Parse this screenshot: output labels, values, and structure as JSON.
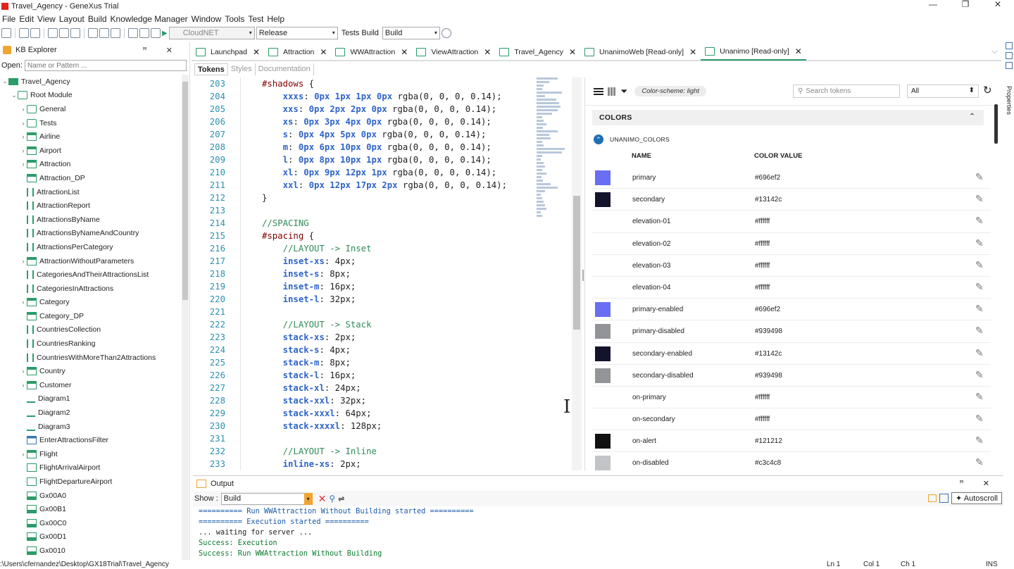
{
  "window": {
    "title": "Travel_Agency - GeneXus Trial",
    "controls": [
      "—",
      "❐",
      "✕"
    ]
  },
  "menu": [
    "File",
    "Edit",
    "View",
    "Layout",
    "Build",
    "Knowledge Manager",
    "Window",
    "Tools",
    "Test",
    "Help"
  ],
  "toolbar": {
    "platform": "CloudNET",
    "configuration": "Release",
    "tests_label": "Tests Build",
    "tests_value": "Build"
  },
  "kb_explorer": {
    "title": "KB Explorer",
    "controls": "ꟸ ✕",
    "open_label": "Open:",
    "open_placeholder": "Name or Pattern ...",
    "tree": [
      {
        "label": "Travel_Agency",
        "exp": "⌄",
        "indent": 0,
        "icon": "kb"
      },
      {
        "label": "Root Module",
        "exp": "⌄",
        "indent": 1,
        "icon": "folder"
      },
      {
        "label": "General",
        "exp": "›",
        "indent": 2,
        "icon": "folder"
      },
      {
        "label": "Tests",
        "exp": "›",
        "indent": 2,
        "icon": "folder"
      },
      {
        "label": "Airline",
        "exp": "›",
        "indent": 2,
        "icon": "trn"
      },
      {
        "label": "Airport",
        "exp": "›",
        "indent": 2,
        "icon": "trn"
      },
      {
        "label": "Attraction",
        "exp": "›",
        "indent": 2,
        "icon": "trn"
      },
      {
        "label": "Attraction_DP",
        "exp": "",
        "indent": 2,
        "icon": "dp"
      },
      {
        "label": "AttractionList",
        "exp": "",
        "indent": 2,
        "icon": "proc"
      },
      {
        "label": "AttractionReport",
        "exp": "",
        "indent": 2,
        "icon": "proc"
      },
      {
        "label": "AttractionsByName",
        "exp": "",
        "indent": 2,
        "icon": "proc"
      },
      {
        "label": "AttractionsByNameAndCountry",
        "exp": "",
        "indent": 2,
        "icon": "proc"
      },
      {
        "label": "AttractionsPerCategory",
        "exp": "",
        "indent": 2,
        "icon": "proc"
      },
      {
        "label": "AttractionWithoutParameters",
        "exp": "›",
        "indent": 2,
        "icon": "trn"
      },
      {
        "label": "CategoriesAndTheirAttractionsList",
        "exp": "",
        "indent": 2,
        "icon": "proc"
      },
      {
        "label": "CategoriesInAttractions",
        "exp": "",
        "indent": 2,
        "icon": "proc"
      },
      {
        "label": "Category",
        "exp": "›",
        "indent": 2,
        "icon": "trn"
      },
      {
        "label": "Category_DP",
        "exp": "",
        "indent": 2,
        "icon": "dp"
      },
      {
        "label": "CountriesCollection",
        "exp": "",
        "indent": 2,
        "icon": "proc"
      },
      {
        "label": "CountriesRanking",
        "exp": "",
        "indent": 2,
        "icon": "proc"
      },
      {
        "label": "CountriesWithMoreThan2Attractions",
        "exp": "",
        "indent": 2,
        "icon": "proc"
      },
      {
        "label": "Country",
        "exp": "›",
        "indent": 2,
        "icon": "trn"
      },
      {
        "label": "Customer",
        "exp": "›",
        "indent": 2,
        "icon": "trn"
      },
      {
        "label": "Diagram1",
        "exp": "",
        "indent": 2,
        "icon": "diag"
      },
      {
        "label": "Diagram2",
        "exp": "",
        "indent": 2,
        "icon": "diag"
      },
      {
        "label": "Diagram3",
        "exp": "",
        "indent": 2,
        "icon": "diag"
      },
      {
        "label": "EnterAttractionsFilter",
        "exp": "",
        "indent": 2,
        "icon": "wp"
      },
      {
        "label": "Flight",
        "exp": "›",
        "indent": 2,
        "icon": "trn"
      },
      {
        "label": "FlightArrivalAirport",
        "exp": "",
        "indent": 2,
        "icon": "sdt"
      },
      {
        "label": "FlightDepartureAirport",
        "exp": "",
        "indent": 2,
        "icon": "sdt"
      },
      {
        "label": "Gx00A0",
        "exp": "",
        "indent": 2,
        "icon": "wp2"
      },
      {
        "label": "Gx00B1",
        "exp": "",
        "indent": 2,
        "icon": "wp2"
      },
      {
        "label": "Gx00C0",
        "exp": "",
        "indent": 2,
        "icon": "wp2"
      },
      {
        "label": "Gx00D1",
        "exp": "",
        "indent": 2,
        "icon": "wp2"
      },
      {
        "label": "Gx0010",
        "exp": "",
        "indent": 2,
        "icon": "wp2"
      }
    ]
  },
  "tabs": [
    {
      "label": "Launchpad",
      "active": false
    },
    {
      "label": "Attraction",
      "active": false
    },
    {
      "label": "WWAttraction",
      "active": false
    },
    {
      "label": "ViewAttraction",
      "active": false
    },
    {
      "label": "Travel_Agency",
      "active": false
    },
    {
      "label": "UnanimoWeb [Read-only]",
      "active": false
    },
    {
      "label": "Unanimo [Read-only]",
      "active": true
    }
  ],
  "properties_label": "Properties",
  "sub_tabs": [
    {
      "label": "Tokens",
      "active": true
    },
    {
      "label": "Styles",
      "active": false
    },
    {
      "label": "Documentation",
      "active": false
    }
  ],
  "code_lines": [
    {
      "n": "203",
      "parts": [
        [
          "sel",
          "#shadows"
        ],
        [
          "plain",
          " {"
        ]
      ]
    },
    {
      "n": "204",
      "parts": [
        [
          "plain",
          "    "
        ],
        [
          "prop",
          "xxxs"
        ],
        [
          "plain",
          ": "
        ],
        [
          "num",
          "0px 1px 1px 0px"
        ],
        [
          "plain",
          " rgba(0, 0, 0, 0.14);"
        ]
      ]
    },
    {
      "n": "205",
      "parts": [
        [
          "plain",
          "    "
        ],
        [
          "prop",
          "xxs"
        ],
        [
          "plain",
          ": "
        ],
        [
          "num",
          "0px 2px 2px 0px"
        ],
        [
          "plain",
          " rgba(0, 0, 0, 0.14);"
        ]
      ]
    },
    {
      "n": "206",
      "parts": [
        [
          "plain",
          "    "
        ],
        [
          "prop",
          "xs"
        ],
        [
          "plain",
          ": "
        ],
        [
          "num",
          "0px 3px 4px 0px"
        ],
        [
          "plain",
          " rgba(0, 0, 0, 0.14);"
        ]
      ]
    },
    {
      "n": "207",
      "parts": [
        [
          "plain",
          "    "
        ],
        [
          "prop",
          "s"
        ],
        [
          "plain",
          ": "
        ],
        [
          "num",
          "0px 4px 5px 0px"
        ],
        [
          "plain",
          " rgba(0, 0, 0, 0.14);"
        ]
      ]
    },
    {
      "n": "208",
      "parts": [
        [
          "plain",
          "    "
        ],
        [
          "prop",
          "m"
        ],
        [
          "plain",
          ": "
        ],
        [
          "num",
          "0px 6px 10px 0px"
        ],
        [
          "plain",
          " rgba(0, 0, 0, 0.14);"
        ]
      ]
    },
    {
      "n": "209",
      "parts": [
        [
          "plain",
          "    "
        ],
        [
          "prop",
          "l"
        ],
        [
          "plain",
          ": "
        ],
        [
          "num",
          "0px 8px 10px 1px"
        ],
        [
          "plain",
          " rgba(0, 0, 0, 0.14);"
        ]
      ]
    },
    {
      "n": "210",
      "parts": [
        [
          "plain",
          "    "
        ],
        [
          "prop",
          "xl"
        ],
        [
          "plain",
          ": "
        ],
        [
          "num",
          "0px 9px 12px 1px"
        ],
        [
          "plain",
          " rgba(0, 0, 0, 0.14);"
        ]
      ]
    },
    {
      "n": "211",
      "parts": [
        [
          "plain",
          "    "
        ],
        [
          "prop",
          "xxl"
        ],
        [
          "plain",
          ": "
        ],
        [
          "num",
          "0px 12px 17px 2px"
        ],
        [
          "plain",
          " rgba(0, 0, 0, 0.14);"
        ]
      ]
    },
    {
      "n": "212",
      "parts": [
        [
          "plain",
          "}"
        ]
      ]
    },
    {
      "n": "213",
      "parts": []
    },
    {
      "n": "214",
      "parts": [
        [
          "comment",
          "//SPACING"
        ]
      ]
    },
    {
      "n": "215",
      "parts": [
        [
          "sel",
          "#spacing"
        ],
        [
          "plain",
          " {"
        ]
      ]
    },
    {
      "n": "216",
      "parts": [
        [
          "plain",
          "    "
        ],
        [
          "comment",
          "//LAYOUT -> Inset"
        ]
      ]
    },
    {
      "n": "217",
      "parts": [
        [
          "plain",
          "    "
        ],
        [
          "prop",
          "inset-xs"
        ],
        [
          "plain",
          ": 4px;"
        ]
      ]
    },
    {
      "n": "218",
      "parts": [
        [
          "plain",
          "    "
        ],
        [
          "prop",
          "inset-s"
        ],
        [
          "plain",
          ": 8px;"
        ]
      ]
    },
    {
      "n": "219",
      "parts": [
        [
          "plain",
          "    "
        ],
        [
          "prop",
          "inset-m"
        ],
        [
          "plain",
          ": 16px;"
        ]
      ]
    },
    {
      "n": "220",
      "parts": [
        [
          "plain",
          "    "
        ],
        [
          "prop",
          "inset-l"
        ],
        [
          "plain",
          ": 32px;"
        ]
      ]
    },
    {
      "n": "221",
      "parts": []
    },
    {
      "n": "222",
      "parts": [
        [
          "plain",
          "    "
        ],
        [
          "comment",
          "//LAYOUT -> Stack"
        ]
      ]
    },
    {
      "n": "223",
      "parts": [
        [
          "plain",
          "    "
        ],
        [
          "prop",
          "stack-xs"
        ],
        [
          "plain",
          ": 2px;"
        ]
      ]
    },
    {
      "n": "224",
      "parts": [
        [
          "plain",
          "    "
        ],
        [
          "prop",
          "stack-s"
        ],
        [
          "plain",
          ": 4px;"
        ]
      ]
    },
    {
      "n": "225",
      "parts": [
        [
          "plain",
          "    "
        ],
        [
          "prop",
          "stack-m"
        ],
        [
          "plain",
          ": 8px;"
        ]
      ]
    },
    {
      "n": "226",
      "parts": [
        [
          "plain",
          "    "
        ],
        [
          "prop",
          "stack-l"
        ],
        [
          "plain",
          ": 16px;"
        ]
      ]
    },
    {
      "n": "227",
      "parts": [
        [
          "plain",
          "    "
        ],
        [
          "prop",
          "stack-xl"
        ],
        [
          "plain",
          ": 24px;"
        ]
      ]
    },
    {
      "n": "228",
      "parts": [
        [
          "plain",
          "    "
        ],
        [
          "prop",
          "stack-xxl"
        ],
        [
          "plain",
          ": 32px;"
        ]
      ]
    },
    {
      "n": "229",
      "parts": [
        [
          "plain",
          "    "
        ],
        [
          "prop",
          "stack-xxxl"
        ],
        [
          "plain",
          ": 64px;"
        ]
      ]
    },
    {
      "n": "230",
      "parts": [
        [
          "plain",
          "    "
        ],
        [
          "prop",
          "stack-xxxxl"
        ],
        [
          "plain",
          ": 128px;"
        ]
      ]
    },
    {
      "n": "231",
      "parts": []
    },
    {
      "n": "232",
      "parts": [
        [
          "plain",
          "    "
        ],
        [
          "comment",
          "//LAYOUT -> Inline"
        ]
      ]
    },
    {
      "n": "233",
      "parts": [
        [
          "plain",
          "    "
        ],
        [
          "prop",
          "inline-xs"
        ],
        [
          "plain",
          ": 2px;"
        ]
      ]
    }
  ],
  "tokens_panel": {
    "scheme_chip": "Color-scheme: light",
    "search_placeholder": "Search tokens",
    "filter_value": "All",
    "section_title": "COLORS",
    "group_title": "UNANIMO_COLORS",
    "col_name": "NAME",
    "col_value": "COLOR VALUE",
    "colors": [
      {
        "name": "primary",
        "value": "#696ef2",
        "swatch": "#696ef2"
      },
      {
        "name": "secondary",
        "value": "#13142c",
        "swatch": "#13142c"
      },
      {
        "name": "elevation-01",
        "value": "#ffffff",
        "swatch": "#ffffff"
      },
      {
        "name": "elevation-02",
        "value": "#ffffff",
        "swatch": "#ffffff"
      },
      {
        "name": "elevation-03",
        "value": "#ffffff",
        "swatch": "#ffffff"
      },
      {
        "name": "elevation-04",
        "value": "#ffffff",
        "swatch": "#ffffff"
      },
      {
        "name": "primary-enabled",
        "value": "#696ef2",
        "swatch": "#696ef2"
      },
      {
        "name": "primary-disabled",
        "value": "#939498",
        "swatch": "#939498"
      },
      {
        "name": "secondary-enabled",
        "value": "#13142c",
        "swatch": "#13142c"
      },
      {
        "name": "secondary-disabled",
        "value": "#939498",
        "swatch": "#939498"
      },
      {
        "name": "on-primary",
        "value": "#ffffff",
        "swatch": "#ffffff"
      },
      {
        "name": "on-secondary",
        "value": "#ffffff",
        "swatch": "#ffffff"
      },
      {
        "name": "on-alert",
        "value": "#121212",
        "swatch": "#121212"
      },
      {
        "name": "on-disabled",
        "value": "#c3c4c8",
        "swatch": "#c3c4c8"
      }
    ]
  },
  "output": {
    "title": "Output",
    "controls": "ꟸ ✕",
    "show_label": "Show :",
    "show_value": "Build",
    "autoscroll_label": "✦ Autoscroll",
    "lines": [
      {
        "text": "========== Run WWAttraction Without Building started ==========",
        "kind": "info"
      },
      {
        "text": "========== Execution started ==========",
        "kind": "info"
      },
      {
        "text": "... waiting for server ...",
        "kind": "plain"
      },
      {
        "text": "Success: Execution",
        "kind": "ok"
      },
      {
        "text": "Success: Run WWAttraction Without Building",
        "kind": "ok"
      }
    ]
  },
  "status": {
    "path": ":\\Users\\cfernandez\\Desktop\\GX18Trial\\Travel_Agency",
    "ln": "Ln 1",
    "col": "Col 1",
    "ch": "Ch 1",
    "mode": "INS"
  }
}
